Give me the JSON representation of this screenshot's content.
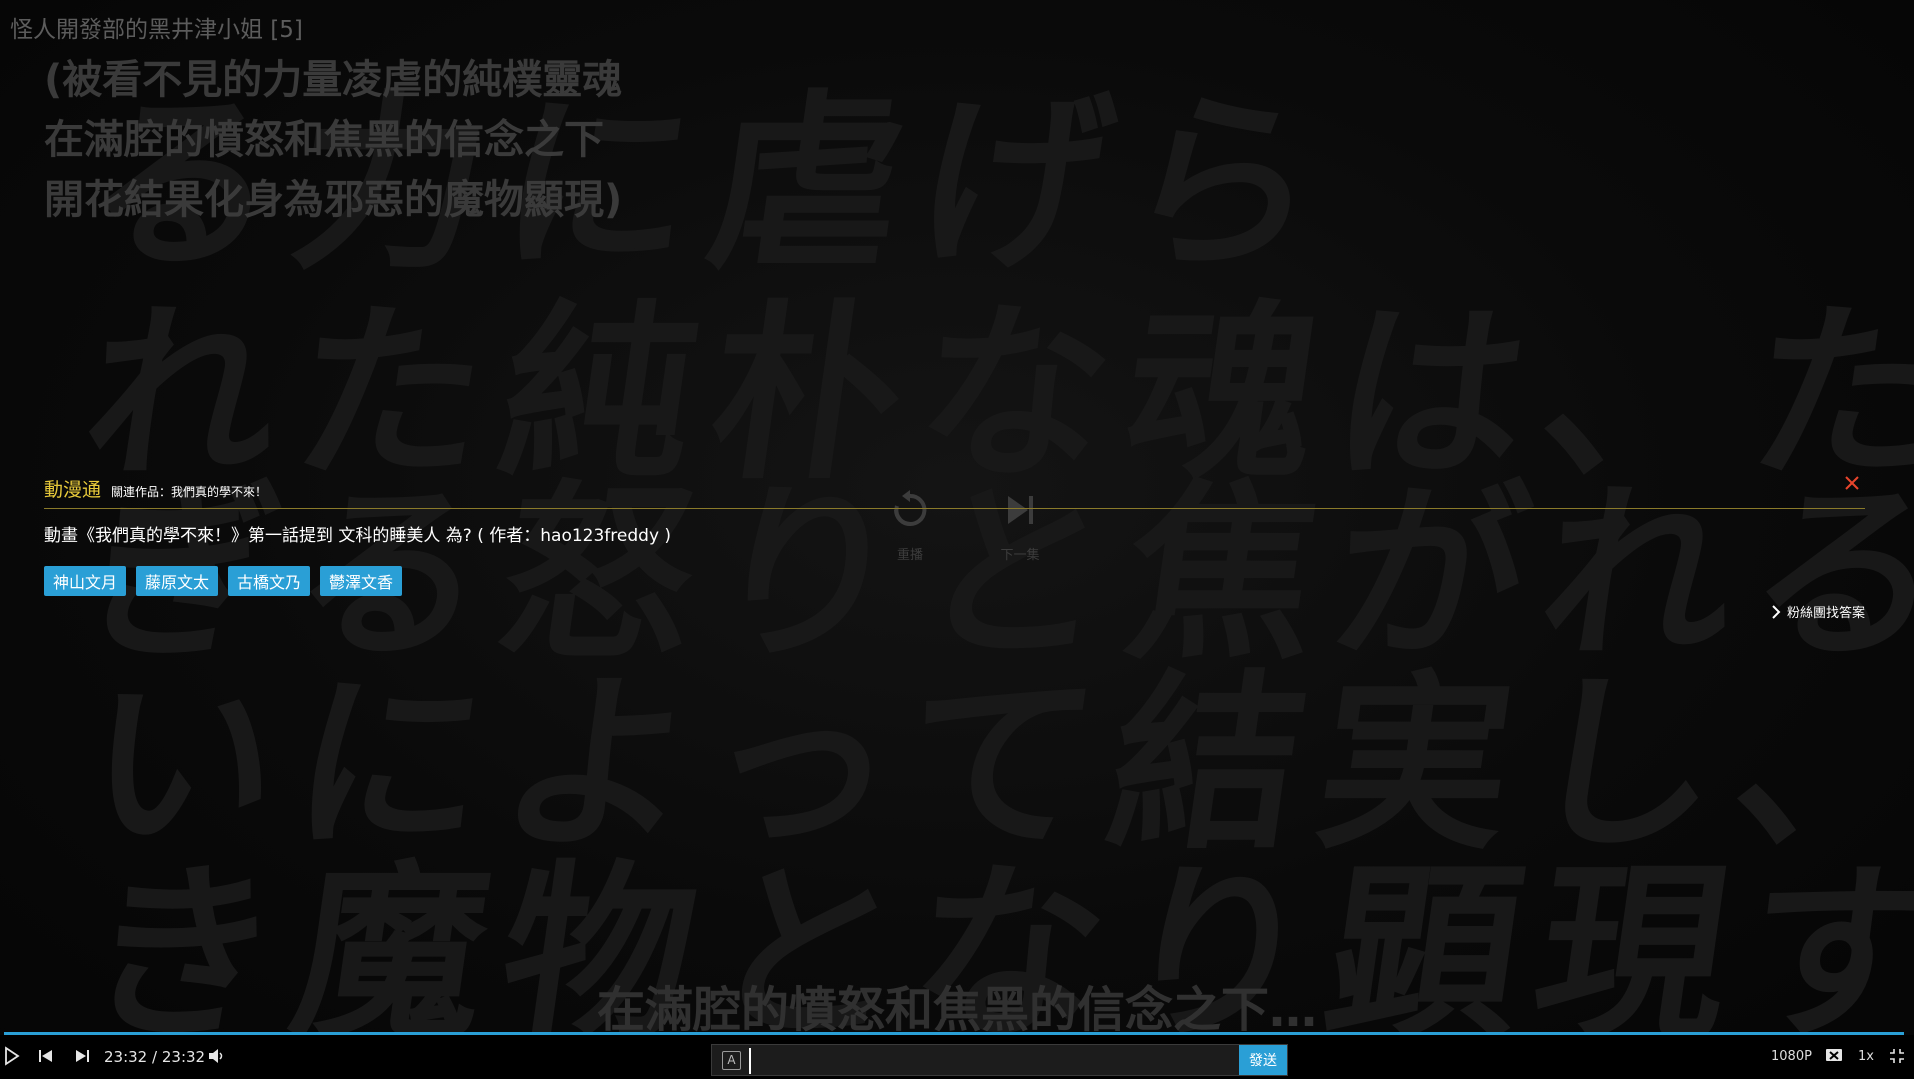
{
  "player": {
    "video_title": "怪人開發部的黑井津小姐 [5]",
    "subtitle_top": [
      "(被看不見的力量凌虐的純樸靈魂",
      "在滿腔的憤怒和焦黑的信念之下",
      "開花結果化身為邪惡的魔物顯現)"
    ],
    "subtitle_bottom": "在滿腔的憤怒和焦黑的信念之下…",
    "background_lines": [
      "る力に虐げら",
      "れた純朴な魂は、た",
      "ぎる怒りと焦がれる想",
      "いによって結実し、悪し",
      "き魔物となり顕現する"
    ]
  },
  "end_screen": {
    "replay_label": "重播",
    "next_label": "下一集"
  },
  "acg_panel": {
    "brand": "動漫通",
    "related": "關連作品：我們真的學不來！",
    "question": "動畫《我們真的學不來！》第一話提到 文科的睡美人 為? ( 作者：hao123freddy )",
    "answers": [
      "神山文月",
      "藤原文太",
      "古橋文乃",
      "鬱澤文香"
    ],
    "fan_link": "粉絲團找答案",
    "accent_color": "#e7c93a",
    "tag_color": "#2a9fd6"
  },
  "controls": {
    "current_time": "23:32",
    "separator": "/",
    "duration": "23:32",
    "progress": 1.0,
    "danmu_icon_text": "A",
    "danmu_placeholder": "",
    "send_label": "發送",
    "quality": "1080P",
    "speed": "1x",
    "progress_color": "#2a9fd6"
  }
}
